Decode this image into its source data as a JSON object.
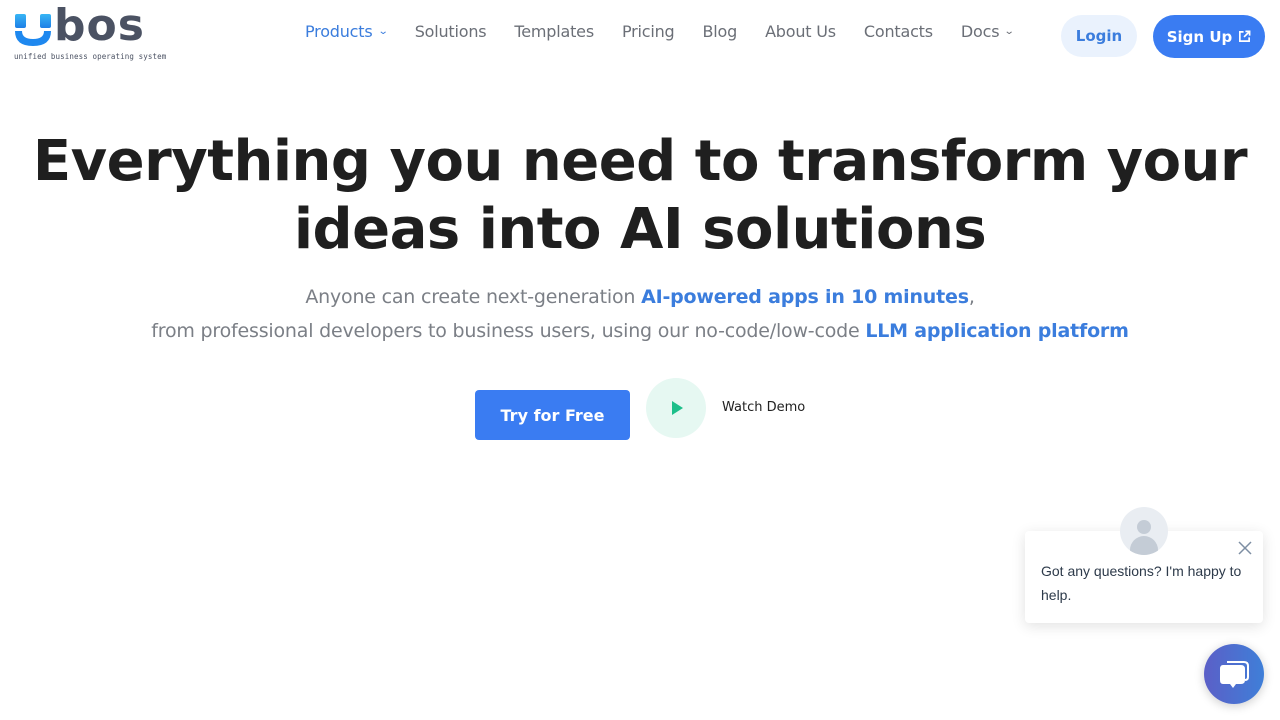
{
  "brand": {
    "logo_word": "bos",
    "logo_tagline": "unified business operating system",
    "colors": {
      "primary": "#3a7cf2",
      "link": "#3b7ddd",
      "text_dark": "#1f1f1f",
      "text_muted": "#7b7f86",
      "play_green": "#1dbf8a"
    }
  },
  "nav": {
    "items": [
      {
        "label": "Products",
        "dropdown": true,
        "active": true
      },
      {
        "label": "Solutions",
        "dropdown": false,
        "active": false
      },
      {
        "label": "Templates",
        "dropdown": false,
        "active": false
      },
      {
        "label": "Pricing",
        "dropdown": false,
        "active": false
      },
      {
        "label": "Blog",
        "dropdown": false,
        "active": false
      },
      {
        "label": "About Us",
        "dropdown": false,
        "active": false
      },
      {
        "label": "Contacts",
        "dropdown": false,
        "active": false
      },
      {
        "label": "Docs",
        "dropdown": true,
        "active": false
      }
    ],
    "caret_glyph": "⌄",
    "login_label": "Login",
    "signup_label": "Sign Up",
    "signup_icon": "external-link-icon"
  },
  "hero": {
    "title_line1": "Everything you need to transform your",
    "title_line2": "ideas into AI solutions",
    "sub_line1_pre": "Anyone can create next-generation ",
    "sub_line1_highlight": "AI-powered apps in 10 minutes",
    "sub_line1_post": ",",
    "sub_line2_pre": "from professional developers to business users, using our no-code/low-code ",
    "sub_line2_highlight": "LLM application platform",
    "cta_primary": "Try for Free",
    "cta_secondary": "Watch Demo",
    "play_icon": "play-icon"
  },
  "chat": {
    "message": "Got any questions? I'm happy to help.",
    "avatar_icon": "user-avatar-icon",
    "close_icon": "close-icon",
    "launcher_icon": "chat-bubbles-icon"
  }
}
